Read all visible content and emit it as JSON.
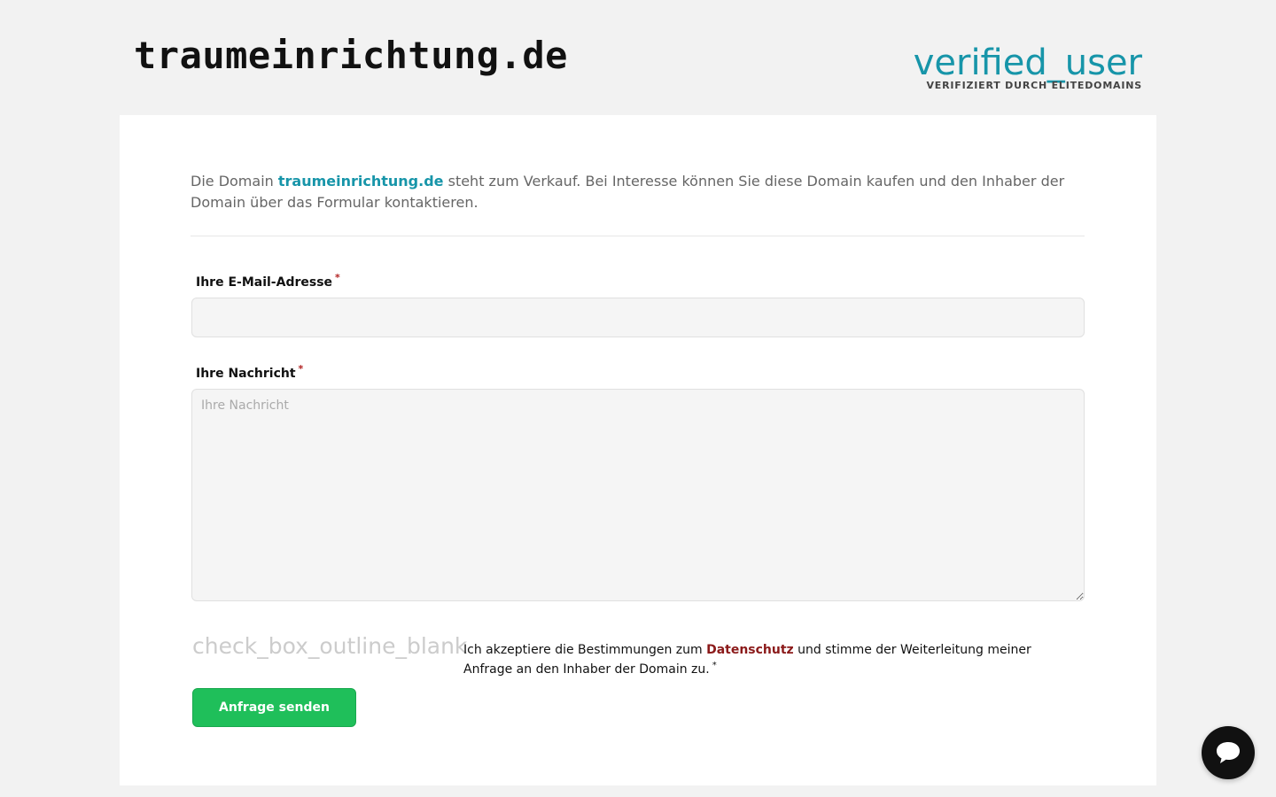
{
  "header": {
    "site_title": "traumeinrichtung.de",
    "verified_icon": "verified_user",
    "verified_text": "VERIFIZIERT DURCH ELITEDOMAINS"
  },
  "intro": {
    "prefix": "Die Domain ",
    "domain": "traumeinrichtung.de",
    "suffix": " steht zum Verkauf. Bei Interesse können Sie diese Domain kaufen und den Inhaber der Domain über das Formular kontaktieren."
  },
  "form": {
    "email_label": "Ihre E-Mail-Adresse",
    "email_value": "",
    "message_label": "Ihre Nachricht",
    "message_placeholder": "Ihre Nachricht",
    "required_mark": "*",
    "consent_icon": "check_box_outline_blank",
    "consent_prefix": "Ich akzeptiere die Bestimmungen zum ",
    "consent_link": "Datenschutz",
    "consent_suffix": " und stimme der Weiterleitung meiner Anfrage an den Inhaber der Domain zu.",
    "submit_label": "Anfrage senden"
  },
  "colors": {
    "accent": "#1795a9",
    "submit": "#1fbf5a",
    "link": "#8b1a1a",
    "chat": "#111111"
  },
  "chat": {
    "icon": "chat-bubble-icon"
  }
}
